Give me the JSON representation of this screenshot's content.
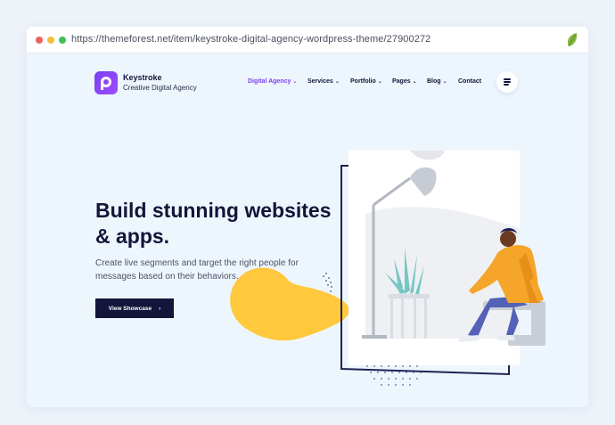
{
  "browser": {
    "url": "https://themeforest.net/item/keystroke-digital-agency-wordpress-theme/27900272"
  },
  "header": {
    "brand_name": "Keystroke",
    "brand_tagline": "Creative Digital Agency",
    "nav": [
      {
        "label": "Digital Agency",
        "active": true,
        "dropdown": true
      },
      {
        "label": "Services",
        "active": false,
        "dropdown": true
      },
      {
        "label": "Portfolio",
        "active": false,
        "dropdown": true
      },
      {
        "label": "Pages",
        "active": false,
        "dropdown": true
      },
      {
        "label": "Blog",
        "active": false,
        "dropdown": true
      },
      {
        "label": "Contact",
        "active": false,
        "dropdown": false
      }
    ]
  },
  "hero": {
    "title_line1": "Build stunning websites",
    "title_line2": "& apps.",
    "subtitle": "Create live segments and target the right people for messages based on their behaviors.",
    "cta_label": "View Showcase",
    "cta_arrow": "›"
  },
  "colors": {
    "accent": "#7b3ff2",
    "navy": "#13153a",
    "yellow": "#ffc83d",
    "orange": "#f5a52a"
  }
}
